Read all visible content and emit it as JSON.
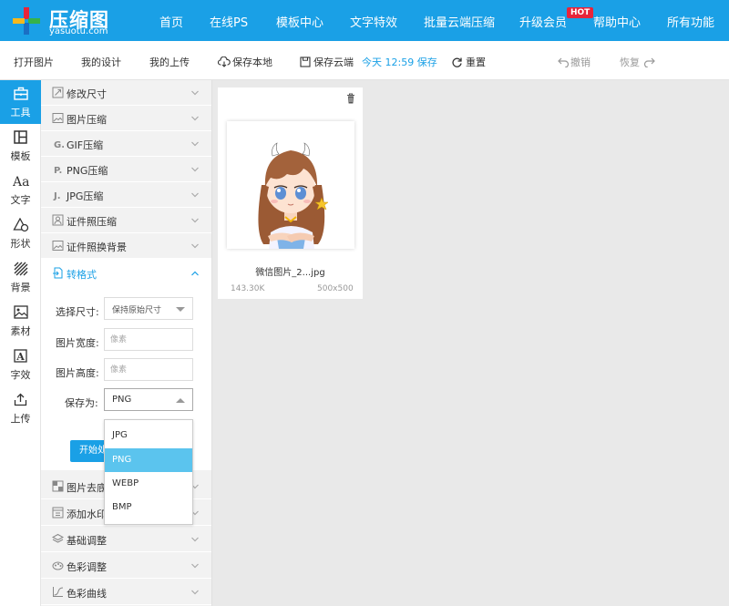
{
  "brand": {
    "name": "压缩图",
    "domain": "yasuotu.com",
    "colors": {
      "primary": "#1aa0e6",
      "hot": "#e7243b",
      "selected_option": "#5bc4ee"
    }
  },
  "nav": {
    "items": [
      {
        "label": "首页"
      },
      {
        "label": "在线PS"
      },
      {
        "label": "模板中心"
      },
      {
        "label": "文字特效"
      },
      {
        "label": "批量云端压缩"
      },
      {
        "label": "升级会员"
      },
      {
        "label": "帮助中心"
      },
      {
        "label": "所有功能"
      }
    ],
    "hot_badge": "HOT"
  },
  "toolbar": {
    "open_image": "打开图片",
    "my_designs": "我的设计",
    "my_uploads": "我的上传",
    "save_local": "保存本地",
    "save_cloud": "保存云端",
    "save_time": "今天 12:59 保存",
    "reset": "重置",
    "undo": "撤销",
    "redo": "恢复"
  },
  "rail": {
    "items": [
      {
        "label": "工具",
        "icon": "toolbox-icon",
        "active": true
      },
      {
        "label": "模板",
        "icon": "layout-icon"
      },
      {
        "label": "文字",
        "icon": "text-icon"
      },
      {
        "label": "形状",
        "icon": "shapes-icon"
      },
      {
        "label": "背景",
        "icon": "hatch-icon"
      },
      {
        "label": "素材",
        "icon": "image-icon"
      },
      {
        "label": "字效",
        "icon": "text-effect-icon"
      },
      {
        "label": "上传",
        "icon": "upload-icon"
      }
    ]
  },
  "panel": {
    "sections": [
      {
        "label": "修改尺寸"
      },
      {
        "label": "图片压缩"
      },
      {
        "label": "GIF压缩"
      },
      {
        "label": "PNG压缩"
      },
      {
        "label": "JPG压缩"
      },
      {
        "label": "证件照压缩"
      },
      {
        "label": "证件照换背景"
      },
      {
        "label": "转格式",
        "open": true
      },
      {
        "label": "图片去底"
      },
      {
        "label": "添加水印"
      },
      {
        "label": "基础调整"
      },
      {
        "label": "色彩调整"
      },
      {
        "label": "色彩曲线"
      }
    ],
    "convert": {
      "size_label": "选择尺寸:",
      "size_value": "保持原始尺寸",
      "width_label": "图片宽度:",
      "width_placeholder": "像素",
      "height_label": "图片高度:",
      "height_placeholder": "像素",
      "save_as_label": "保存为:",
      "save_as_value": "PNG",
      "start_button": "开始处理",
      "format_options": [
        "JPG",
        "PNG",
        "WEBP",
        "BMP"
      ],
      "selected_option": "PNG"
    }
  },
  "canvas": {
    "file": {
      "name": "微信图片_2...jpg",
      "size": "143.30K",
      "dimensions": "500x500"
    }
  }
}
